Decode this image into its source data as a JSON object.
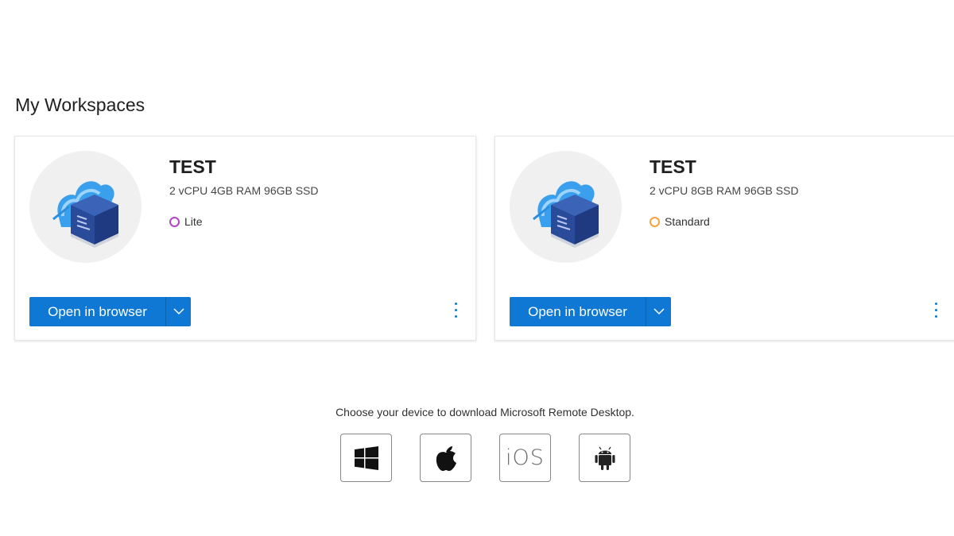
{
  "page": {
    "title": "My Workspaces"
  },
  "workspaces": [
    {
      "name": "TEST",
      "spec": "2 vCPU 4GB RAM 96GB SSD",
      "tier": "Lite",
      "tier_color": "#b146c2",
      "open_label": "Open in browser"
    },
    {
      "name": "TEST",
      "spec": "2 vCPU 8GB RAM 96GB SSD",
      "tier": "Standard",
      "tier_color": "#f5a43b",
      "open_label": "Open in browser"
    }
  ],
  "download": {
    "text": "Choose your device to download Microsoft Remote Desktop.",
    "devices": [
      {
        "icon": "windows-icon"
      },
      {
        "icon": "apple-icon"
      },
      {
        "icon": "ios-icon",
        "label": "iOS"
      },
      {
        "icon": "android-icon"
      }
    ]
  },
  "colors": {
    "primary": "#0f78d4"
  }
}
